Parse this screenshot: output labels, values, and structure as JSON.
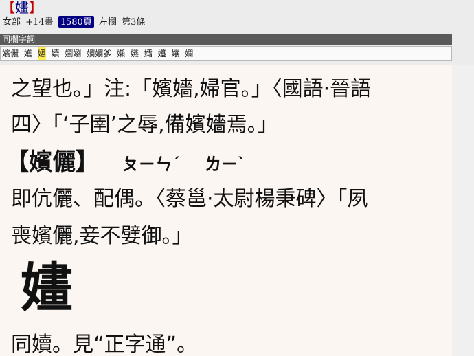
{
  "header": {
    "bracket_open": "【",
    "char": "嫿",
    "bracket_close": "】",
    "radical": "女部",
    "strokes": "+14畫",
    "page": "1580頁",
    "column": "左欄",
    "entry": "第3條"
  },
  "group": {
    "title": "同欄字詞",
    "items": [
      "嬪儷",
      "嬳",
      "嬺",
      "嬻",
      "嬼嬼",
      "嬽嬽爹",
      "嬾",
      "嬿",
      "孀",
      "孂",
      "孃",
      "孄"
    ]
  },
  "scan": {
    "lines": [
      "之望也。」注:「嬪嬙,婦官。」〈國語·晉語",
      "四〉「‘子圉’之辱,備嬪嬙焉。」",
      "即伉儷、配偶。〈蔡邕·太尉楊秉碑〉「夙",
      "喪嬪儷,妾不嬖御。」",
      "同嬻。見“正字通”。"
    ],
    "entry_head": "【嬪儷】",
    "phonetic_1": "ㄆㄧㄣˊ",
    "phonetic_2": "ㄌㄧˋ",
    "big_char": "嫿"
  }
}
